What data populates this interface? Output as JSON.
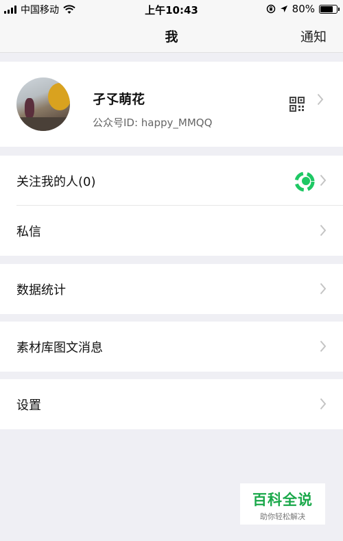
{
  "status_bar": {
    "carrier": "中国移动",
    "time": "上午10:43",
    "battery": "80%",
    "battery_level": 0.8
  },
  "nav": {
    "title": "我",
    "right": "通知"
  },
  "profile": {
    "name": "孑孓萌花",
    "id_text": "公众号ID: happy_MMQQ"
  },
  "menu": {
    "followers": "关注我的人(0)",
    "messages": "私信",
    "statistics": "数据统计",
    "library": "素材库图文消息",
    "settings": "设置"
  },
  "watermark": {
    "title": "百科全说",
    "subtitle": "助你轻松解决"
  },
  "colors": {
    "accent_green": "#1aa84a",
    "background": "#efeff4"
  },
  "icons": [
    "signal-icon",
    "wifi-icon",
    "lock-rotation-icon",
    "location-icon",
    "battery-icon",
    "qr-code-icon",
    "chevron-right-icon",
    "loading-spinner-icon"
  ]
}
